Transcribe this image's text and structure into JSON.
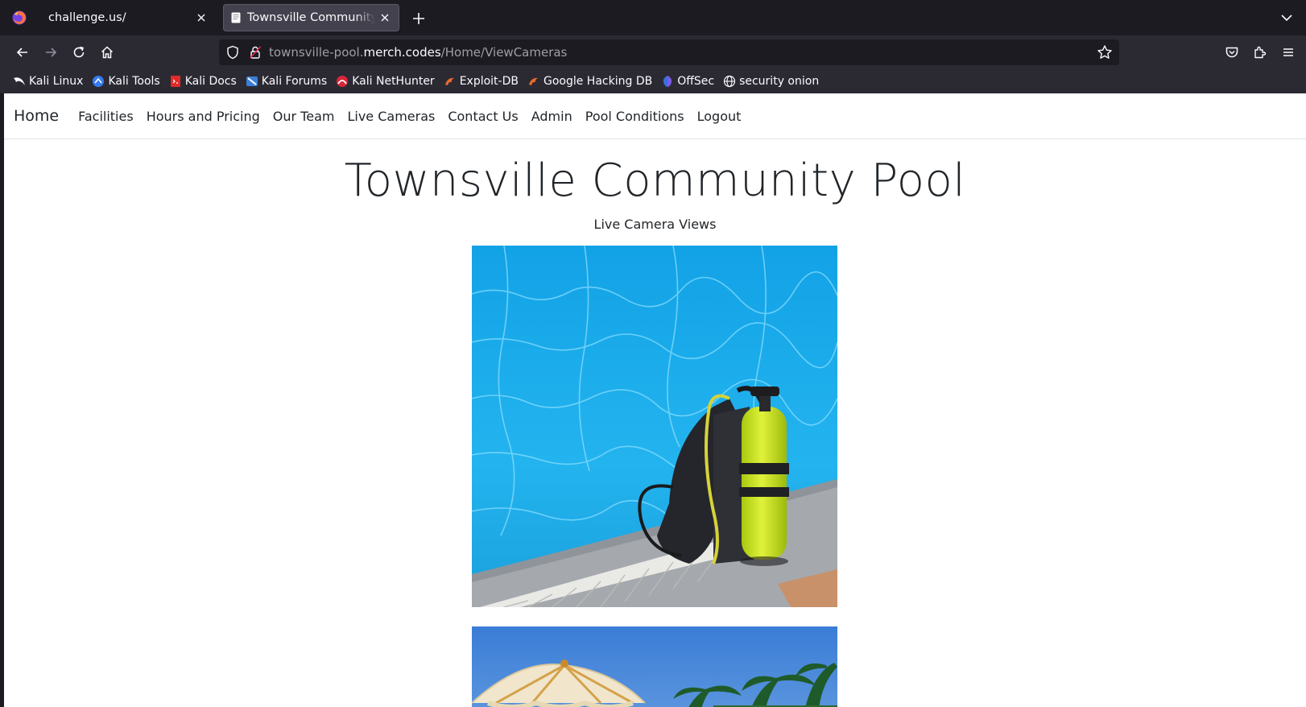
{
  "browser": {
    "tabs": [
      {
        "title": "challenge.us/",
        "active": false
      },
      {
        "title": "Townsville Community Pool",
        "active": true
      }
    ],
    "url": {
      "prefix": "townsville-pool.",
      "host": "merch.codes",
      "path": "/Home/ViewCameras"
    },
    "bookmarks": [
      {
        "label": "Kali Linux",
        "icon": "kali-dragon-icon"
      },
      {
        "label": "Kali Tools",
        "icon": "kali-tools-icon"
      },
      {
        "label": "Kali Docs",
        "icon": "kali-docs-icon"
      },
      {
        "label": "Kali Forums",
        "icon": "kali-forums-icon"
      },
      {
        "label": "Kali NetHunter",
        "icon": "nethunter-icon"
      },
      {
        "label": "Exploit-DB",
        "icon": "exploit-db-icon"
      },
      {
        "label": "Google Hacking DB",
        "icon": "ghdb-icon"
      },
      {
        "label": "OffSec",
        "icon": "offsec-icon"
      },
      {
        "label": "security onion",
        "icon": "globe-icon"
      }
    ]
  },
  "site": {
    "brand": "Home",
    "nav": [
      "Facilities",
      "Hours and Pricing",
      "Our Team",
      "Live Cameras",
      "Contact Us",
      "Admin",
      "Pool Conditions",
      "Logout"
    ],
    "title": "Townsville Community Pool",
    "subtitle": "Live Camera Views",
    "cameras": [
      {
        "scene": "pool-edge-scuba-tank"
      },
      {
        "scene": "umbrella-palm-trees"
      }
    ]
  },
  "colors": {
    "chrome_dark": "#1c1b22",
    "toolbar": "#2b2a33",
    "active_tab": "#42414d",
    "pool_water": "#1fa9e8",
    "scuba_tank": "#cde61a"
  }
}
